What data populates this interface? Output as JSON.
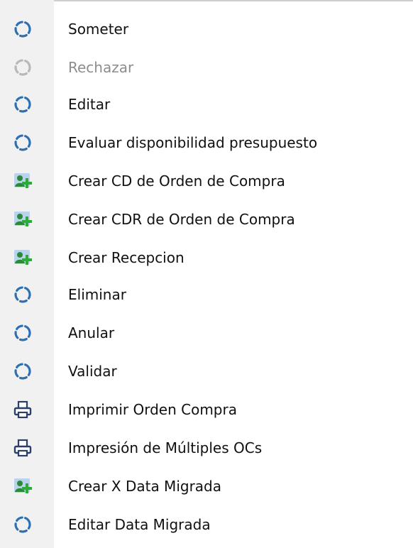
{
  "menu": {
    "items": [
      {
        "label": "Someter",
        "icon": "refresh-icon",
        "disabled": false
      },
      {
        "label": "Rechazar",
        "icon": "refresh-icon",
        "disabled": true
      },
      {
        "label": "Editar",
        "icon": "refresh-icon",
        "disabled": false
      },
      {
        "label": "Evaluar disponibilidad presupuesto",
        "icon": "refresh-icon",
        "disabled": false
      },
      {
        "label": "Crear CD de Orden de Compra",
        "icon": "add-user-icon",
        "disabled": false
      },
      {
        "label": "Crear CDR de Orden de Compra",
        "icon": "add-user-icon",
        "disabled": false
      },
      {
        "label": "Crear Recepcion",
        "icon": "add-user-icon",
        "disabled": false
      },
      {
        "label": "Eliminar",
        "icon": "refresh-icon",
        "disabled": false
      },
      {
        "label": "Anular",
        "icon": "refresh-icon",
        "disabled": false
      },
      {
        "label": "Validar",
        "icon": "refresh-icon",
        "disabled": false
      },
      {
        "label": "Imprimir Orden Compra",
        "icon": "printer-icon",
        "disabled": false
      },
      {
        "label": "Impresión de Múltiples OCs",
        "icon": "printer-icon",
        "disabled": false
      },
      {
        "label": "Crear X Data Migrada",
        "icon": "add-user-icon",
        "disabled": false
      },
      {
        "label": "Editar Data Migrada",
        "icon": "refresh-icon",
        "disabled": false
      }
    ]
  },
  "colors": {
    "refresh_icon": "#2d6fb3",
    "refresh_icon_disabled": "#b8b8b8",
    "add_user_person": "#2a8a3a",
    "add_user_plus": "#2eaa3a",
    "add_user_bg": "#8ab9e8",
    "printer_icon": "#2a3f6a",
    "text": "#101010",
    "text_disabled": "#8d8d8d"
  }
}
